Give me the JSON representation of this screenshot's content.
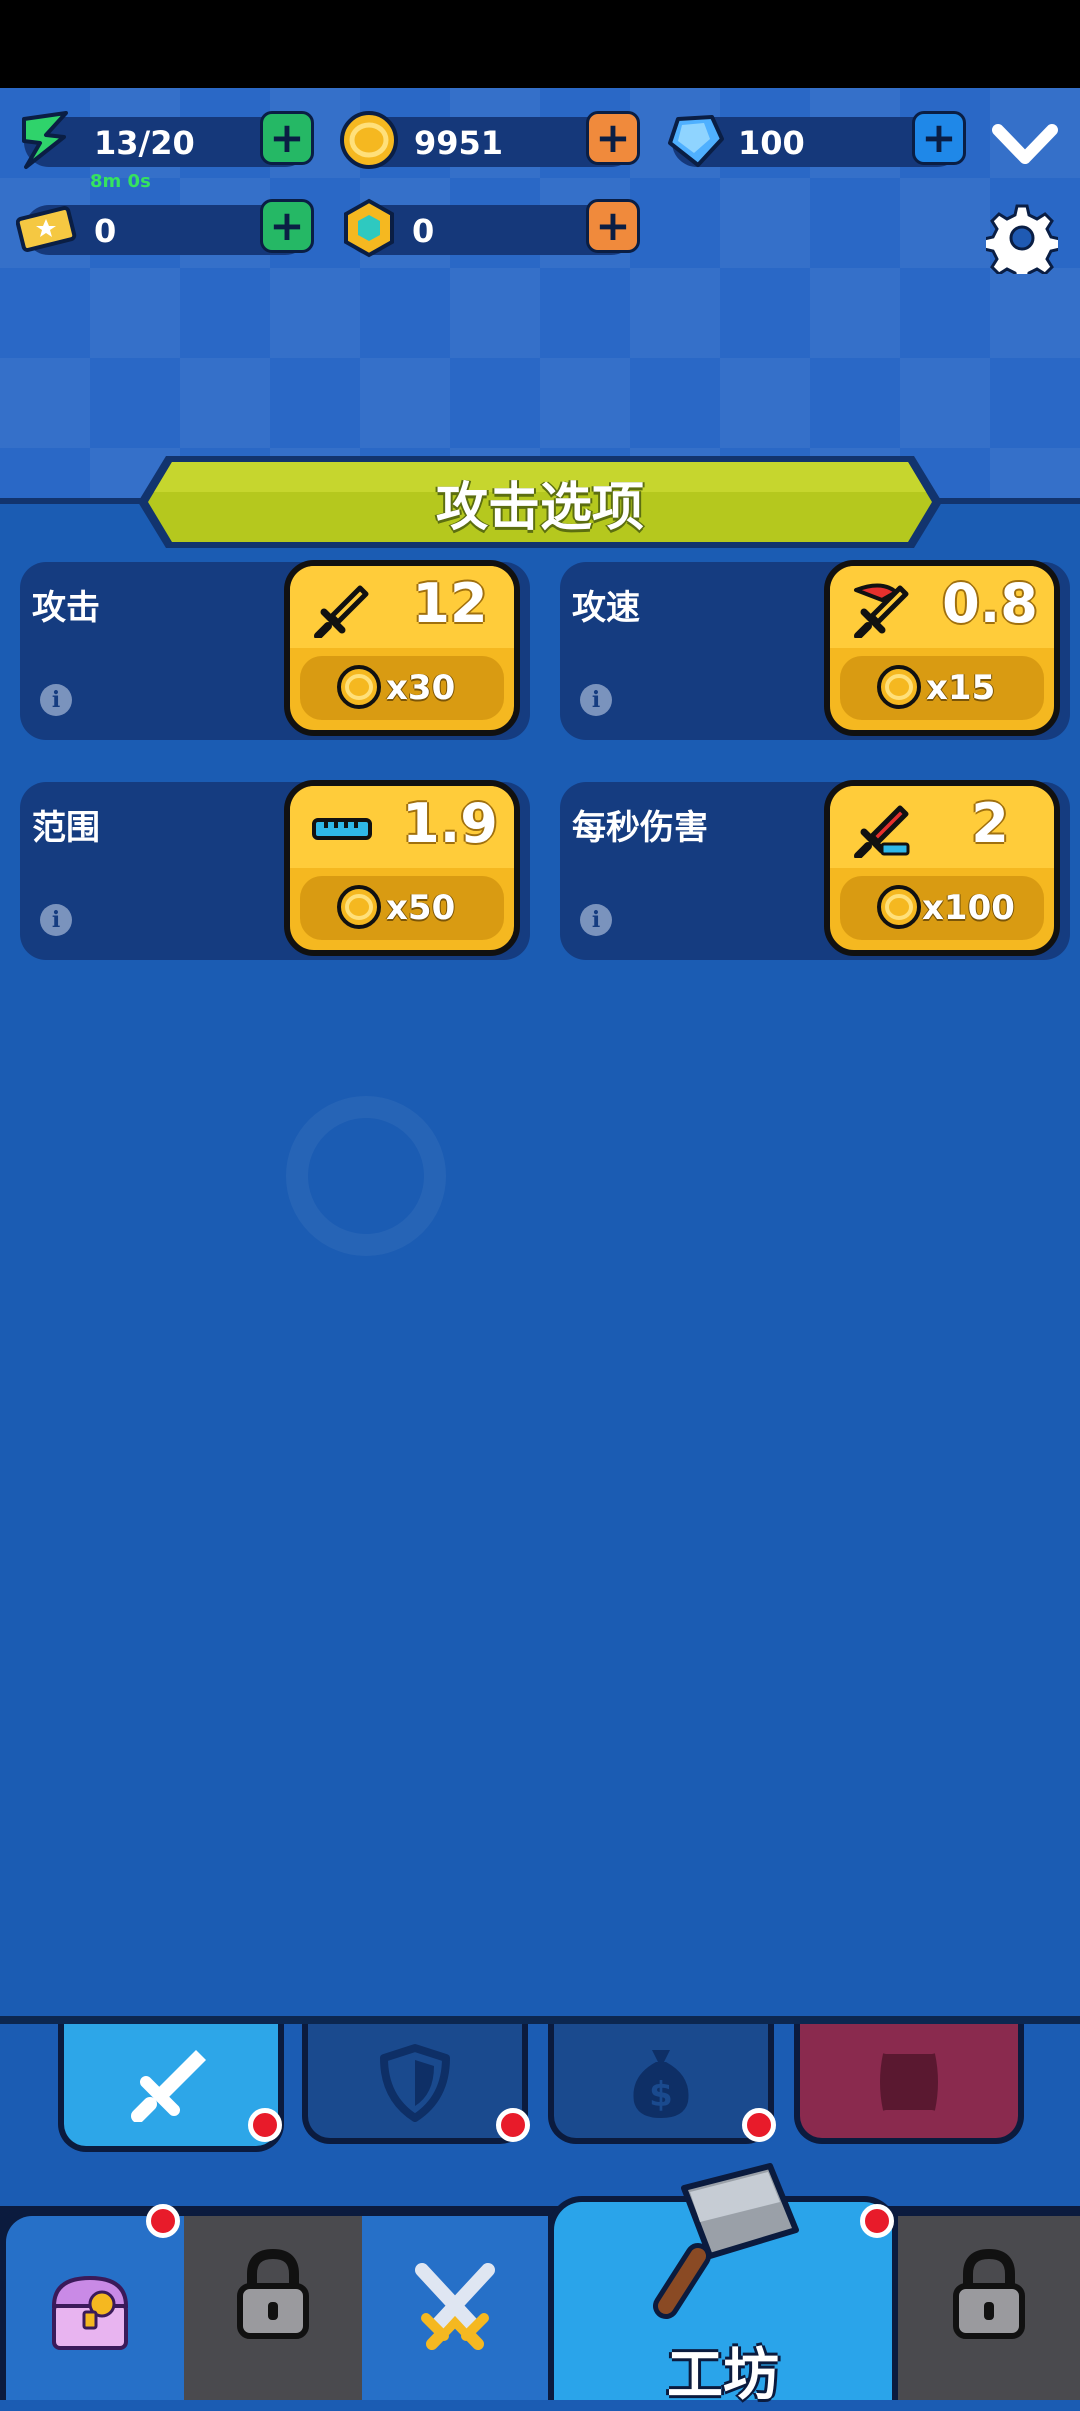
{
  "resources": {
    "energy": {
      "value": "13/20",
      "timer": "8m 0s"
    },
    "coins": {
      "value": "9951"
    },
    "gems": {
      "value": "100"
    },
    "tickets": {
      "value": "0"
    },
    "tokens": {
      "value": "0"
    }
  },
  "banner": {
    "title": "攻击选项"
  },
  "stats": [
    {
      "label": "攻击",
      "value": "12",
      "cost": "x30",
      "icon": "sword-icon"
    },
    {
      "label": "攻速",
      "value": "0.8",
      "cost": "x15",
      "icon": "speed-sword-icon"
    },
    {
      "label": "范围",
      "value": "1.9",
      "cost": "x50",
      "icon": "ruler-icon"
    },
    {
      "label": "每秒伤害",
      "value": "2",
      "cost": "x100",
      "icon": "dps-sword-icon"
    }
  ],
  "subtabs": [
    "attack-tab",
    "defense-tab",
    "economy-tab",
    "locked-tab"
  ],
  "nav": {
    "active_label": "工坊"
  },
  "colors": {
    "accent": "#f5b820",
    "banner": "#b5c81e",
    "badge": "#e81b2a",
    "panel": "#1b5cb3"
  }
}
